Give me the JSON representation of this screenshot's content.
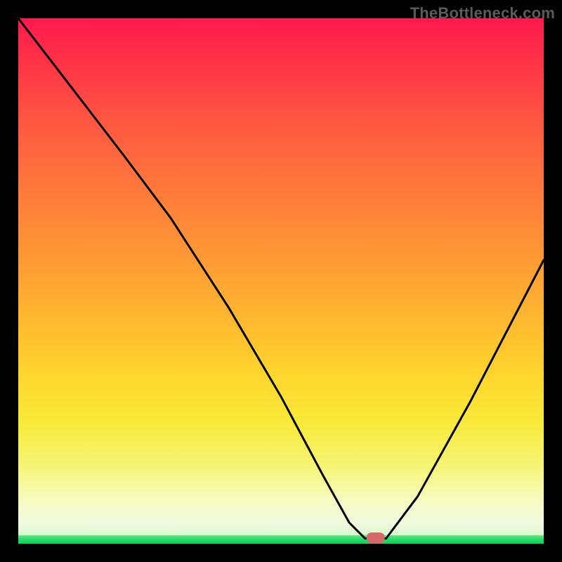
{
  "watermark": "TheBottleneck.com",
  "chart_data": {
    "type": "line",
    "title": "",
    "xlabel": "",
    "ylabel": "",
    "xlim": [
      0,
      100
    ],
    "ylim": [
      0,
      100
    ],
    "grid": false,
    "legend": false,
    "series": [
      {
        "name": "curve",
        "x": [
          0,
          10,
          20,
          29,
          40,
          50,
          58,
          63,
          66,
          70,
          76,
          86,
          100
        ],
        "values": [
          100,
          87,
          74,
          62,
          45,
          28,
          13,
          4,
          1,
          1,
          9,
          27,
          54
        ]
      }
    ],
    "marker": {
      "x": 68,
      "y": 1.2
    },
    "background_gradient": {
      "stops": [
        {
          "pos": 0,
          "color": "#ff1a4d"
        },
        {
          "pos": 20,
          "color": "#ff5842"
        },
        {
          "pos": 46,
          "color": "#ff9a34"
        },
        {
          "pos": 68,
          "color": "#ffd62d"
        },
        {
          "pos": 85,
          "color": "#f6f574"
        },
        {
          "pos": 100,
          "color": "#22dd66"
        }
      ]
    }
  }
}
